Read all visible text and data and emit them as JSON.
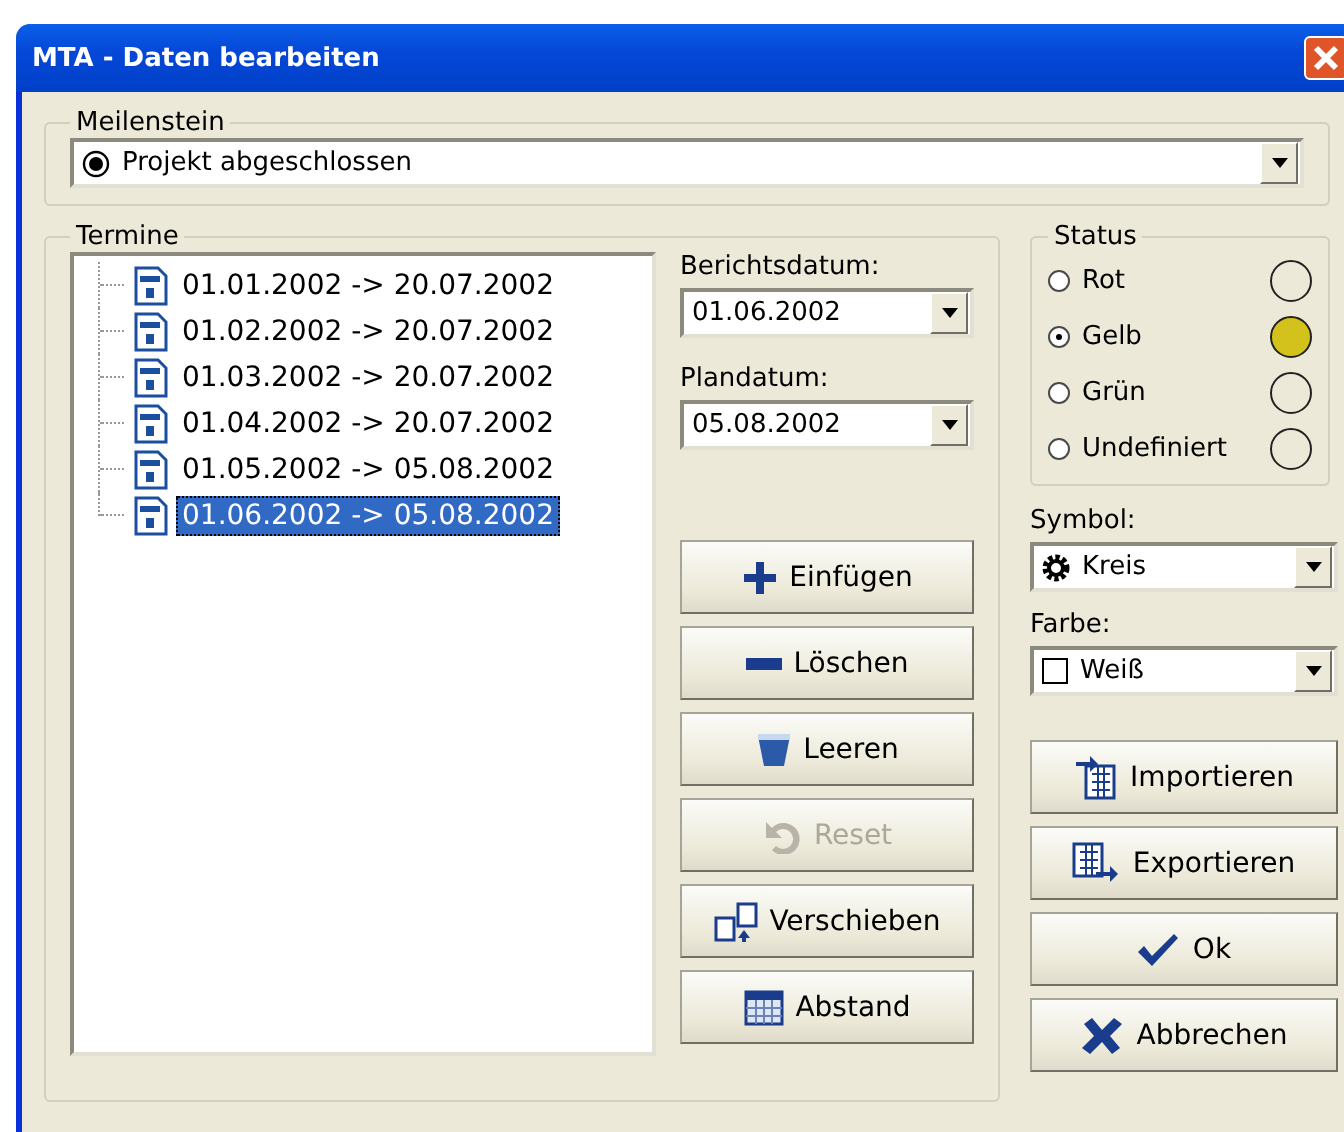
{
  "window": {
    "title": "MTA - Daten bearbeiten"
  },
  "milestone": {
    "label": "Meilenstein",
    "value": "Projekt abgeschlossen"
  },
  "appointments": {
    "label": "Termine",
    "items": [
      {
        "text": "01.01.2002 -> 20.07.2002",
        "selected": false
      },
      {
        "text": "01.02.2002 -> 20.07.2002",
        "selected": false
      },
      {
        "text": "01.03.2002 -> 20.07.2002",
        "selected": false
      },
      {
        "text": "01.04.2002 -> 20.07.2002",
        "selected": false
      },
      {
        "text": "01.05.2002 -> 05.08.2002",
        "selected": false
      },
      {
        "text": "01.06.2002 -> 05.08.2002",
        "selected": true
      }
    ]
  },
  "report_date": {
    "label": "Berichtsdatum:",
    "value": "01.06.2002"
  },
  "plan_date": {
    "label": "Plandatum:",
    "value": "05.08.2002"
  },
  "actions": [
    {
      "label": "Einfügen",
      "kind": "insert",
      "disabled": false
    },
    {
      "label": "Löschen",
      "kind": "delete",
      "disabled": false
    },
    {
      "label": "Leeren",
      "kind": "clear",
      "disabled": false
    },
    {
      "label": "Reset",
      "kind": "reset",
      "disabled": true
    },
    {
      "label": "Verschieben",
      "kind": "move",
      "disabled": false
    },
    {
      "label": "Abstand",
      "kind": "spacing",
      "disabled": false
    }
  ],
  "status": {
    "label": "Status",
    "options": [
      {
        "label": "Rot",
        "selected": false,
        "color": "#ece9d8"
      },
      {
        "label": "Gelb",
        "selected": true,
        "color": "#d4c21c"
      },
      {
        "label": "Grün",
        "selected": false,
        "color": "#ece9d8"
      },
      {
        "label": "Undefiniert",
        "selected": false,
        "color": "#ece9d8"
      }
    ]
  },
  "symbol": {
    "label": "Symbol:",
    "value": "Kreis"
  },
  "color": {
    "label": "Farbe:",
    "value": "Weiß"
  },
  "buttons": [
    {
      "label": "Importieren",
      "kind": "import"
    },
    {
      "label": "Exportieren",
      "kind": "export"
    },
    {
      "label": "Ok",
      "kind": "ok"
    },
    {
      "label": "Abbrechen",
      "kind": "cancel"
    }
  ]
}
